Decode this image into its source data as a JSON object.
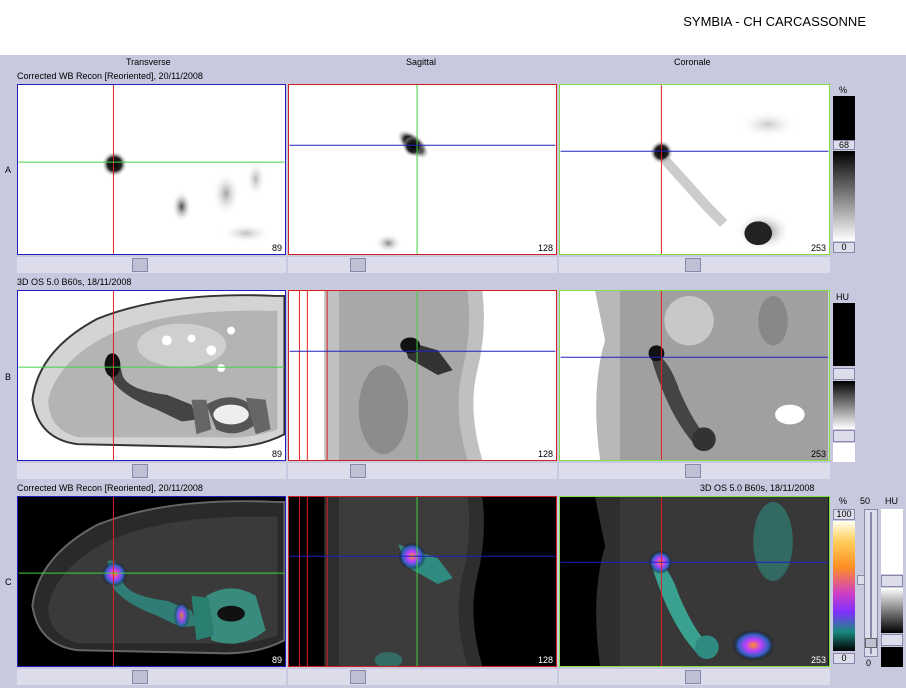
{
  "header": {
    "site": "SYMBIA - CH CARCASSONNE"
  },
  "columns": {
    "transverse": "Transverse",
    "sagittal": "Sagittal",
    "coronal": "Coronale"
  },
  "rows": {
    "a": {
      "letter": "A",
      "info": "Corrected WB Recon [Reoriented], 20/11/2008"
    },
    "b": {
      "letter": "B",
      "info": "3D  OS  5.0  B60s, 18/11/2008"
    },
    "c": {
      "letter": "C",
      "info_left": "Corrected WB Recon [Reoriented], 20/11/2008",
      "info_right": "3D  OS  5.0  B60s, 18/11/2008"
    }
  },
  "slices": {
    "transverse": "89",
    "sagittal": "128",
    "coronal": "253"
  },
  "scales": {
    "a": {
      "unit": "%",
      "max": "68",
      "min": "0"
    },
    "b": {
      "unit": "HU"
    },
    "c": {
      "unit": "%",
      "max": "100",
      "min": "0",
      "fusion_value": "50",
      "fusion_min": "0",
      "ct_unit": "HU"
    }
  },
  "colors": {
    "transverse_border": "#2020c0",
    "sagittal_border": "#d02020",
    "coronal_border": "#80e040",
    "crosshair_red": "#e02020",
    "crosshair_green": "#40d040",
    "crosshair_blue": "#2020c0"
  }
}
